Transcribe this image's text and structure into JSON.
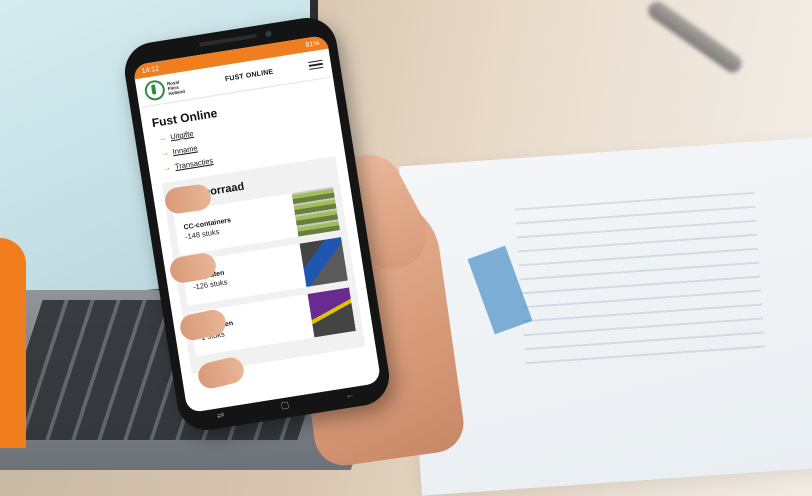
{
  "status": {
    "time": "14:12",
    "battery": "81%"
  },
  "header": {
    "logo_text": "Royal Flora Holland",
    "title": "FUST ONLINE"
  },
  "page": {
    "title": "Fust Online",
    "links": [
      {
        "label": "Uitgifte"
      },
      {
        "label": "Inname"
      },
      {
        "label": "Transacties"
      }
    ]
  },
  "voorraad": {
    "title": "Mijn voorraad",
    "items": [
      {
        "name": "CC-containers",
        "count": "-148 stuks",
        "image": "cc-containers-image"
      },
      {
        "name": "CC-platen",
        "count": "-126 stuks",
        "image": "cc-platen-image"
      },
      {
        "name": "Slotplaten",
        "count": "1 stuks",
        "image": "slotplaten-image"
      }
    ]
  },
  "navbar": {
    "recent": "⇌",
    "home": "▢",
    "back": "←"
  },
  "colors": {
    "accent": "#f07d1e",
    "brand_green": "#2e8b3e"
  }
}
